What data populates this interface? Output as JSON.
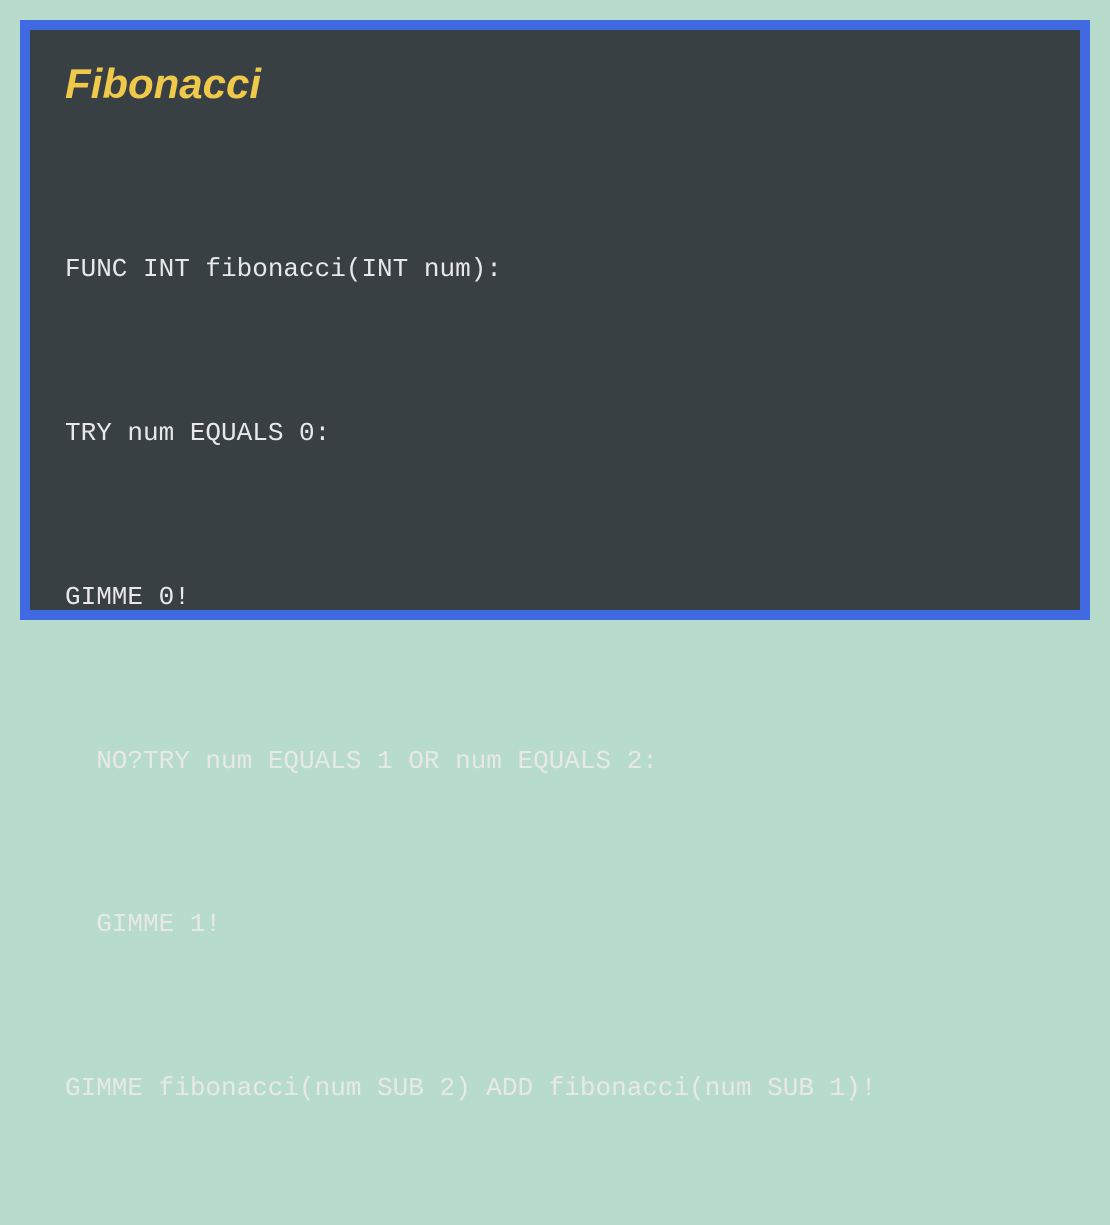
{
  "title": "Fibonacci",
  "code": {
    "line1": "FUNC INT fibonacci(INT num):",
    "line2": "TRY num EQUALS 0:",
    "line3": "GIMME 0!",
    "line4": "  NO?TRY num EQUALS 1 OR num EQUALS 2:",
    "line5": "  GIMME 1!",
    "line6": "GIMME fibonacci(num SUB 2) ADD fibonacci(num SUB 1)!"
  },
  "colors": {
    "background": "#b8dccb",
    "border": "#4169e1",
    "panel": "#384044",
    "title": "#f0c94a",
    "code": "#e8e8e8"
  }
}
